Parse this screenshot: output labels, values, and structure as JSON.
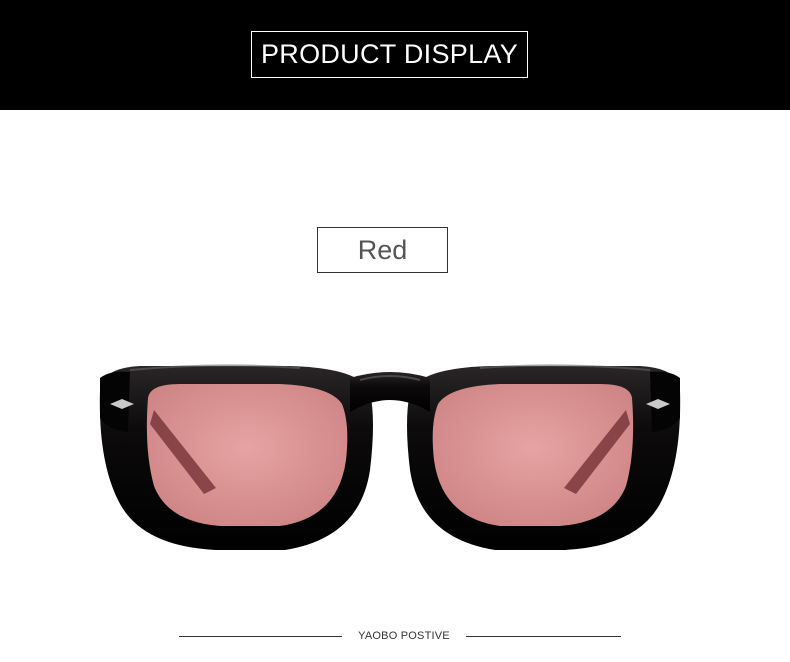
{
  "header": {
    "title": "PRODUCT DISPLAY"
  },
  "variant": {
    "color_label": "Red"
  },
  "product_image": {
    "icon": "sunglasses-icon",
    "lens_color": "#d98f8f",
    "frame_color": "#0c0a0b"
  },
  "footer": {
    "brand": "YAOBO POSTIVE"
  }
}
